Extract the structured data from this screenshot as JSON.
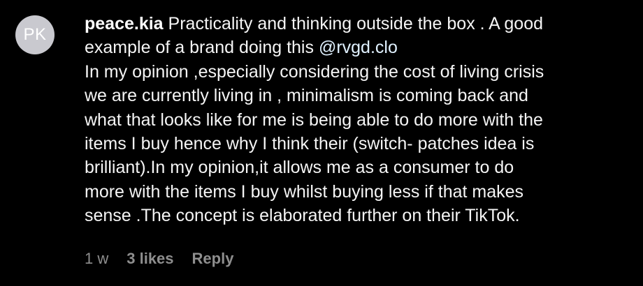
{
  "avatar": {
    "initials": "PK"
  },
  "comment": {
    "username": "peace.kia",
    "first_line_text": "Practicality and thinking outside the box . A good",
    "second_line_prefix": "example of a brand doing this ",
    "mention": "@rvgd.clo",
    "body_lines": [
      "In my opinion ,especially considering the cost of living crisis",
      "we are currently living in , minimalism is coming back and",
      "what that looks like for me is being able to do more with the",
      "items I buy hence why I think their (switch- patches idea is",
      "brilliant).In my opinion,it allows me as a consumer to do",
      "more with the items I buy whilst buying less if that makes",
      "sense .The concept is elaborated further on their TikTok."
    ]
  },
  "meta": {
    "age": "1 w",
    "likes": "3 likes",
    "reply": "Reply"
  },
  "colors": {
    "background": "#000000",
    "text": "#f5f5f5",
    "mention": "#e0f1ff",
    "meta": "#8e8e8e",
    "avatar_bg": "#c9c9cf"
  }
}
